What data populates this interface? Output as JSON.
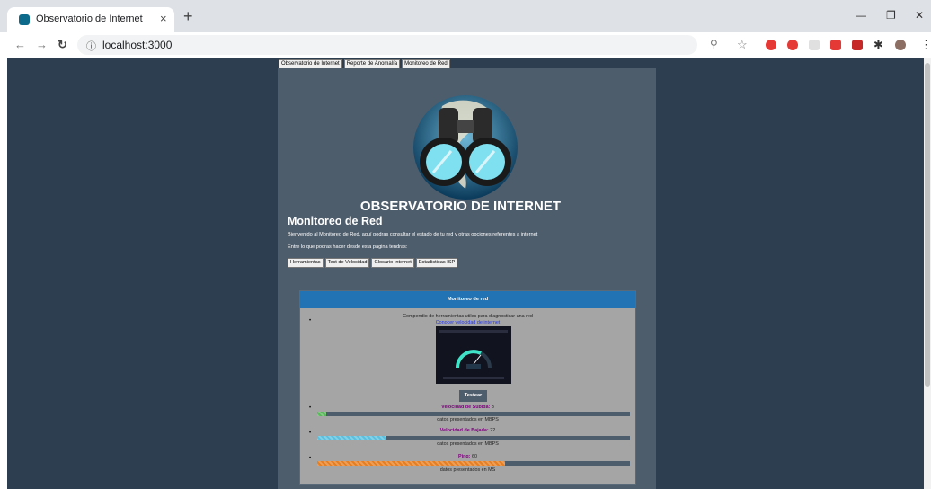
{
  "browser": {
    "tab_title": "Observatorio de Internet",
    "tab_close": "×",
    "new_tab": "+",
    "url": "localhost:3000"
  },
  "nav": {
    "items": [
      "Observatorio de Internet",
      "Reporte de Anomalía",
      "Monitoreo de Red"
    ]
  },
  "header": {
    "brand": "OBSERVATORIO DE INTERNET",
    "title": "Monitoreo de Red",
    "intro": "Bienvenido al Monitoreo de Red, aquí podras consultar el estado de tu red y otras opciones referentes a internet",
    "lead": "Entre lo que podras hacer desde esta pagina tendras:",
    "sections": [
      "Herramientas",
      "Test de Velocidad",
      "Glosario Internet",
      "Estadisticas ISP"
    ]
  },
  "card": {
    "title": "Monitoreo de red",
    "subtitle": "Compendio de herramientas utiles para diagnosticar una red",
    "link": "Conocer velocidad de internet",
    "test_button": "Testear",
    "metrics": [
      {
        "label": "Velocidad de Subida:",
        "value": "3",
        "note": "datos presentados en MBPS",
        "fill_fraction": 0.03,
        "color": "#5cb85c"
      },
      {
        "label": "Velocidad de Bajada:",
        "value": "22",
        "note": "datos presentados en MBPS",
        "fill_fraction": 0.22,
        "color": "#5bc0de"
      },
      {
        "label": "Ping:",
        "value": "60",
        "note": "datos presentados en MS",
        "fill_fraction": 0.6,
        "color": "#e67e22"
      }
    ]
  },
  "colors": {
    "page_bg": "#2c3e50",
    "panel_bg": "#4e5d6c",
    "card_header": "#2173b3"
  }
}
